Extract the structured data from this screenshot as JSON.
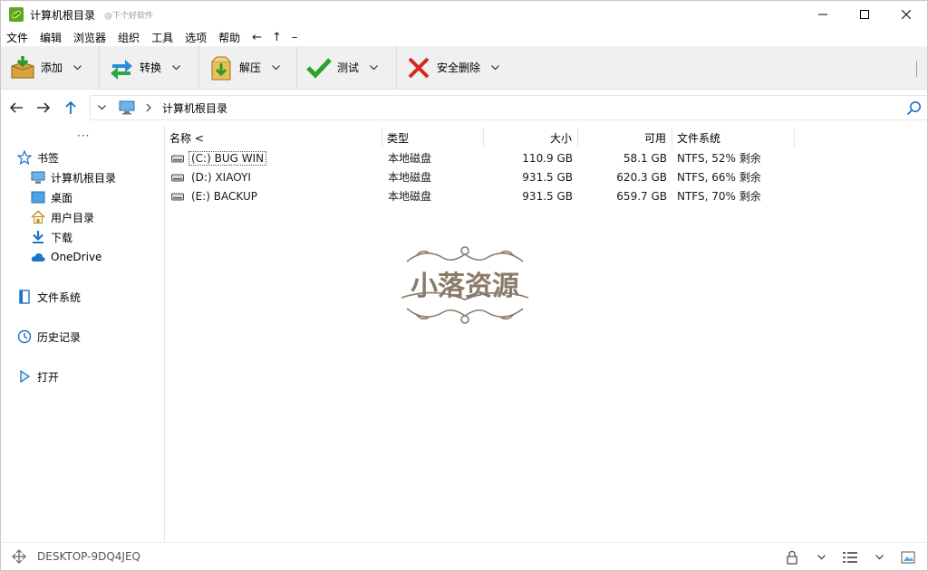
{
  "window": {
    "title": "计算机根目录",
    "subtitle": "@下个好软件"
  },
  "menu": {
    "items": [
      "文件",
      "编辑",
      "浏览器",
      "组织",
      "工具",
      "选项",
      "帮助"
    ],
    "symbols": [
      "←",
      "↑",
      "–"
    ]
  },
  "toolbar": {
    "add": "添加",
    "convert": "转换",
    "extract": "解压",
    "test": "测试",
    "delete": "安全删除"
  },
  "address": {
    "current": "计算机根目录"
  },
  "sidebar": {
    "more": "···",
    "bookmarks": "书签",
    "items": [
      "计算机根目录",
      "桌面",
      "用户目录",
      "下载",
      "OneDrive"
    ],
    "filesystem": "文件系统",
    "history": "历史记录",
    "open": "打开"
  },
  "columns": {
    "name": "名称 <",
    "type": "类型",
    "size": "大小",
    "free": "可用",
    "fs": "文件系统"
  },
  "rows": [
    {
      "name": "(C:) BUG WIN",
      "type": "本地磁盘",
      "size": "110.9 GB",
      "free": "58.1 GB",
      "fs": "NTFS, 52% 剩余"
    },
    {
      "name": "(D:) XIAOYI",
      "type": "本地磁盘",
      "size": "931.5 GB",
      "free": "620.3 GB",
      "fs": "NTFS, 66% 剩余"
    },
    {
      "name": "(E:) BACKUP",
      "type": "本地磁盘",
      "size": "931.5 GB",
      "free": "659.7 GB",
      "fs": "NTFS, 70% 剩余"
    }
  ],
  "watermark": {
    "text": "小落资源"
  },
  "status": {
    "computer": "DESKTOP-9DQ4JEQ"
  },
  "colors": {
    "accent": "#1e73c8",
    "toolbar_bg": "#f0f0f0",
    "watermark": "#8a7a6a"
  }
}
